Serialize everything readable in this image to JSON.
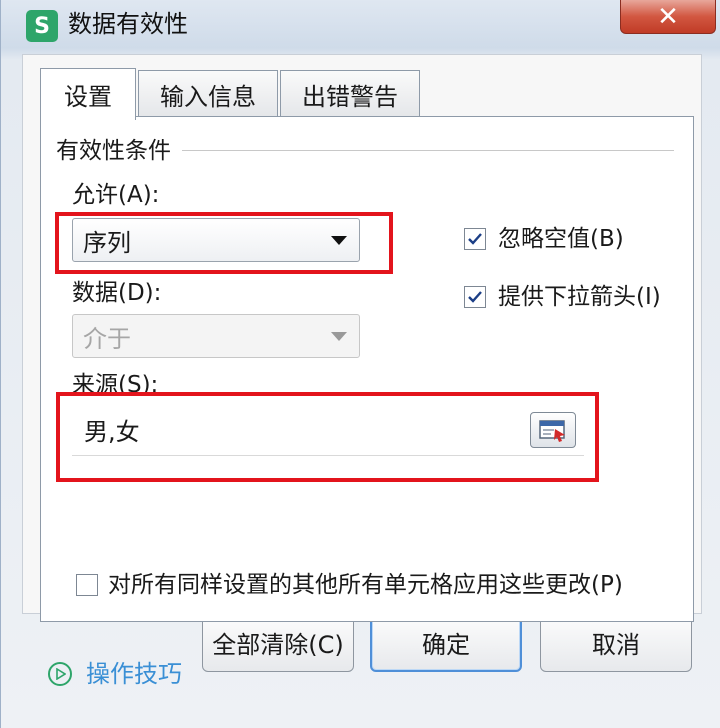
{
  "window": {
    "title": "数据有效性",
    "app_icon_letter": "S",
    "close_symbol": "✕"
  },
  "tabs": [
    {
      "label": "设置",
      "active": true
    },
    {
      "label": "输入信息",
      "active": false
    },
    {
      "label": "出错警告",
      "active": false
    }
  ],
  "settings": {
    "group_title": "有效性条件",
    "allow_label": "允许(A):",
    "allow_value": "序列",
    "data_label": "数据(D):",
    "data_value": "介于",
    "data_disabled": true,
    "ignore_blank_label": "忽略空值(B)",
    "ignore_blank_checked": true,
    "dropdown_arrow_label": "提供下拉箭头(I)",
    "dropdown_arrow_checked": true,
    "source_label": "来源(S):",
    "source_value": "男,女",
    "apply_all_label": "对所有同样设置的其他所有单元格应用这些更改(P)",
    "apply_all_checked": false
  },
  "footer": {
    "tips_link": "操作技巧",
    "clear_all": "全部清除(C)",
    "ok": "确定",
    "cancel": "取消"
  },
  "colors": {
    "highlight": "#e3141c",
    "brand_green": "#2ea56a",
    "link_blue": "#3a8fd5",
    "close_red": "#c03b26"
  }
}
